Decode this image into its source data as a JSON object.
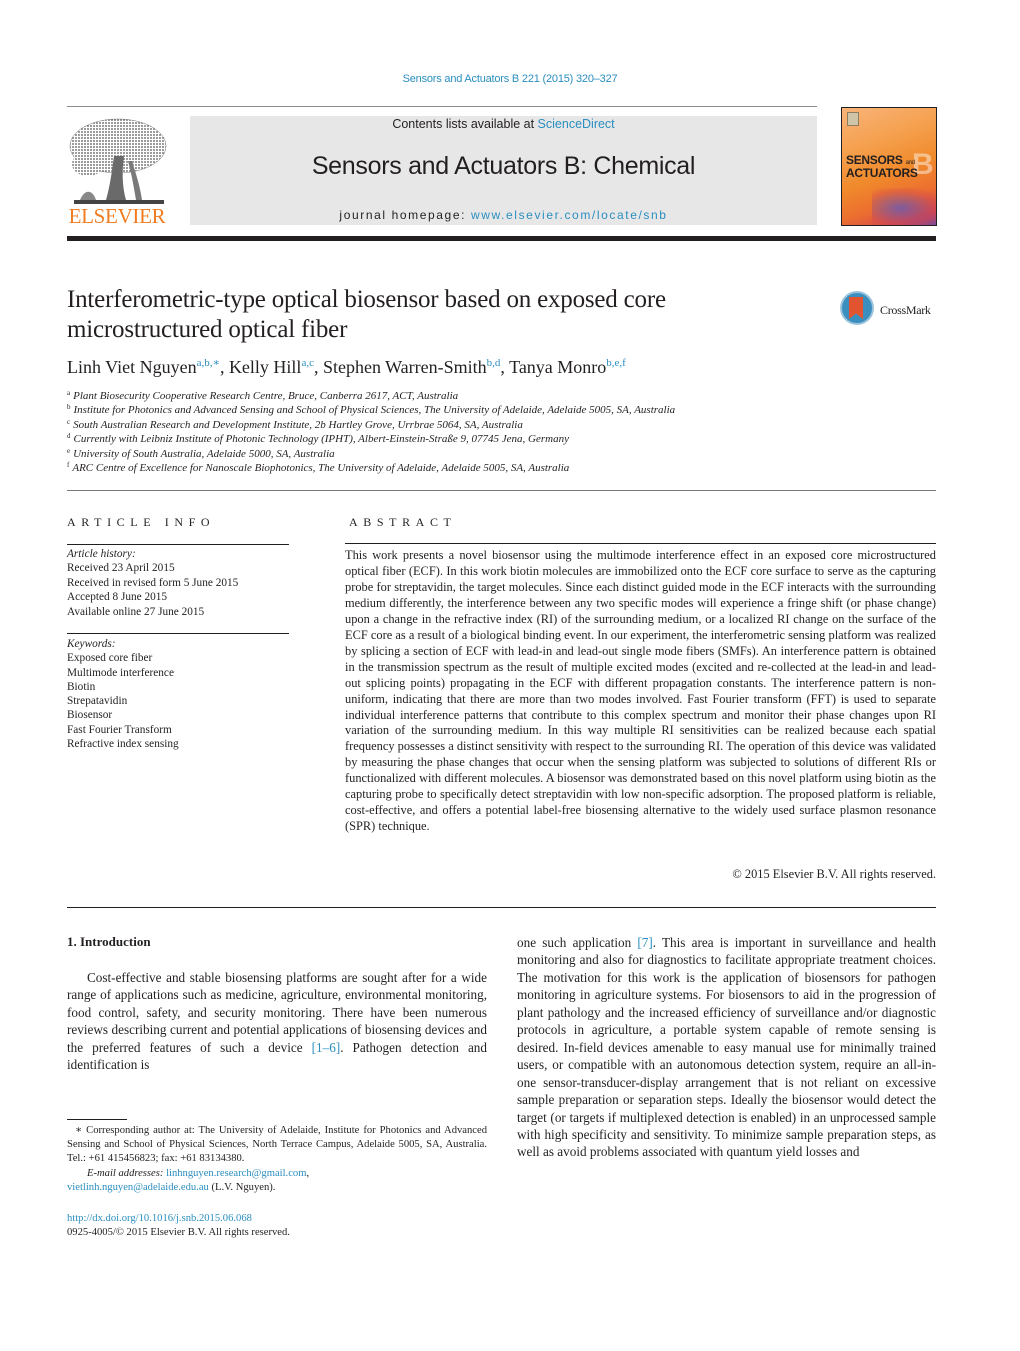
{
  "running_head": "Sensors and Actuators B 221 (2015) 320–327",
  "publisher": {
    "logo_word": "ELSEVIER",
    "logo_icon": "elsevier-tree-icon"
  },
  "banner": {
    "contents_prefix": "Contents lists available at ",
    "contents_link": "ScienceDirect",
    "journal_title": "Sensors and Actuators B: Chemical",
    "homepage_prefix": "journal homepage: ",
    "homepage_link": "www.elsevier.com/locate/snb"
  },
  "cover": {
    "line1": "SENSORS",
    "line1_small": "and",
    "line2": "ACTUATORS",
    "letter": "B"
  },
  "article": {
    "title": "Interferometric-type optical biosensor based on exposed core microstructured optical fiber",
    "crossmark_label": "CrossMark",
    "authors": [
      {
        "name": "Linh Viet Nguyen",
        "sup": "a,b,∗",
        "sep": ", "
      },
      {
        "name": "Kelly Hill",
        "sup": "a,c",
        "sep": ", "
      },
      {
        "name": "Stephen Warren-Smith",
        "sup": "b,d",
        "sep": ", "
      },
      {
        "name": "Tanya Monro",
        "sup": "b,e,f",
        "sep": ""
      }
    ],
    "affiliations": [
      {
        "key": "a",
        "text": "Plant Biosecurity Cooperative Research Centre, Bruce, Canberra 2617, ACT, Australia"
      },
      {
        "key": "b",
        "text": "Institute for Photonics and Advanced Sensing and School of Physical Sciences, The University of Adelaide, Adelaide 5005, SA, Australia"
      },
      {
        "key": "c",
        "text": "South Australian Research and Development Institute, 2b Hartley Grove, Urrbrae 5064, SA, Australia"
      },
      {
        "key": "d",
        "text": "Currently with Leibniz Institute of Photonic Technology (IPHT), Albert-Einstein-Straße 9, 07745 Jena, Germany"
      },
      {
        "key": "e",
        "text": "University of South Australia, Adelaide 5000, SA, Australia"
      },
      {
        "key": "f",
        "text": "ARC Centre of Excellence for Nanoscale Biophotonics, The University of Adelaide, Adelaide 5005, SA, Australia"
      }
    ]
  },
  "article_info": {
    "heading": "ARTICLE INFO",
    "history_label": "Article history:",
    "history": [
      "Received 23 April 2015",
      "Received in revised form 5 June 2015",
      "Accepted 8 June 2015",
      "Available online 27 June 2015"
    ],
    "keywords_label": "Keywords:",
    "keywords": [
      "Exposed core fiber",
      "Multimode interference",
      "Biotin",
      "Strepatavidin",
      "Biosensor",
      "Fast Fourier Transform",
      "Refractive index sensing"
    ]
  },
  "abstract": {
    "heading": "ABSTRACT",
    "text": "This work presents a novel biosensor using the multimode interference effect in an exposed core microstructured optical fiber (ECF). In this work biotin molecules are immobilized onto the ECF core surface to serve as the capturing probe for streptavidin, the target molecules. Since each distinct guided mode in the ECF interacts with the surrounding medium differently, the interference between any two specific modes will experience a fringe shift (or phase change) upon a change in the refractive index (RI) of the surrounding medium, or a localized RI change on the surface of the ECF core as a result of a biological binding event. In our experiment, the interferometric sensing platform was realized by splicing a section of ECF with lead-in and lead-out single mode fibers (SMFs). An interference pattern is obtained in the transmission spectrum as the result of multiple excited modes (excited and re-collected at the lead-in and lead-out splicing points) propagating in the ECF with different propagation constants. The interference pattern is non-uniform, indicating that there are more than two modes involved. Fast Fourier transform (FFT) is used to separate individual interference patterns that contribute to this complex spectrum and monitor their phase changes upon RI variation of the surrounding medium. In this way multiple RI sensi­tivities can be realized because each spatial frequency possesses a distinct sensitivity with respect to the surrounding RI. The operation of this device was validated by measuring the phase changes that occur when the sensing platform was subjected to solutions of different RIs or functionalized with different molecules. A biosensor was demonstrated based on this novel platform using biotin as the capturing probe to specifically detect streptavidin with low non-specific adsorption. The proposed platform is reli­able, cost-effective, and offers a potential label-free biosensing alternative to the widely used surface plasmon resonance (SPR) technique.",
    "copyright": "© 2015 Elsevier B.V. All rights reserved."
  },
  "body": {
    "section_title": "1.  Introduction",
    "col1_before_ref": "Cost-effective and stable biosensing platforms are sought after for a wide range of applications such as medicine, agriculture, environmental monitoring, food control, safety, and security mon­itoring. There have been numerous reviews describing current and potential applications of biosensing devices and the preferred fea­tures of such a device ",
    "col1_ref": "[1–6]",
    "col1_after_ref": ". Pathogen detection and identification is",
    "col2_before_ref": "one such application ",
    "col2_ref": "[7]",
    "col2_after_ref": ". This area is important in surveillance and health monitoring and also for diagnostics to facilitate appropriate treatment choices. The motivation for this work is the applica­tion of biosensors for pathogen monitoring in agriculture systems. For biosensors to aid in the progression of plant pathology and the increased efficiency of surveillance and/or diagnostic proto­cols in agriculture, a portable system capable of remote sensing is desired. In-field devices amenable to easy manual use for minimally trained users, or compatible with an autonomous detection system, require an all-in-one sensor-transducer-display arrangement that is not reliant on excessive sample preparation or separation steps. Ideally the biosensor would detect the target (or targets if multi­plexed detection is enabled) in an unprocessed sample with high specificity and sensitivity. To minimize sample preparation steps, as well as avoid problems associated with quantum yield losses and"
  },
  "footnote": {
    "corresponding": "∗ Corresponding author at: The University of Adelaide, Institute for Photonics and Advanced Sensing and School of Physical Sciences, North Terrace Campus, Adelaide 5005, SA, Australia. Tel.: +61 415456823; fax: +61 83134380.",
    "email_label": "E-mail addresses: ",
    "email1": "linhnguyen.research@gmail.com",
    "email1_sep": ",",
    "email2": "vietlinh.nguyen@adelaide.edu.au",
    "email2_suffix": " (L.V. Nguyen)."
  },
  "doi": {
    "link": "http://dx.doi.org/10.1016/j.snb.2015.06.068",
    "issn_line": "0925-4005/© 2015 Elsevier B.V. All rights reserved."
  },
  "colors": {
    "link": "#2a8ebf",
    "elsevier_orange": "#f07c21",
    "banner_bg": "#e7e7e8",
    "text": "#231f20"
  }
}
